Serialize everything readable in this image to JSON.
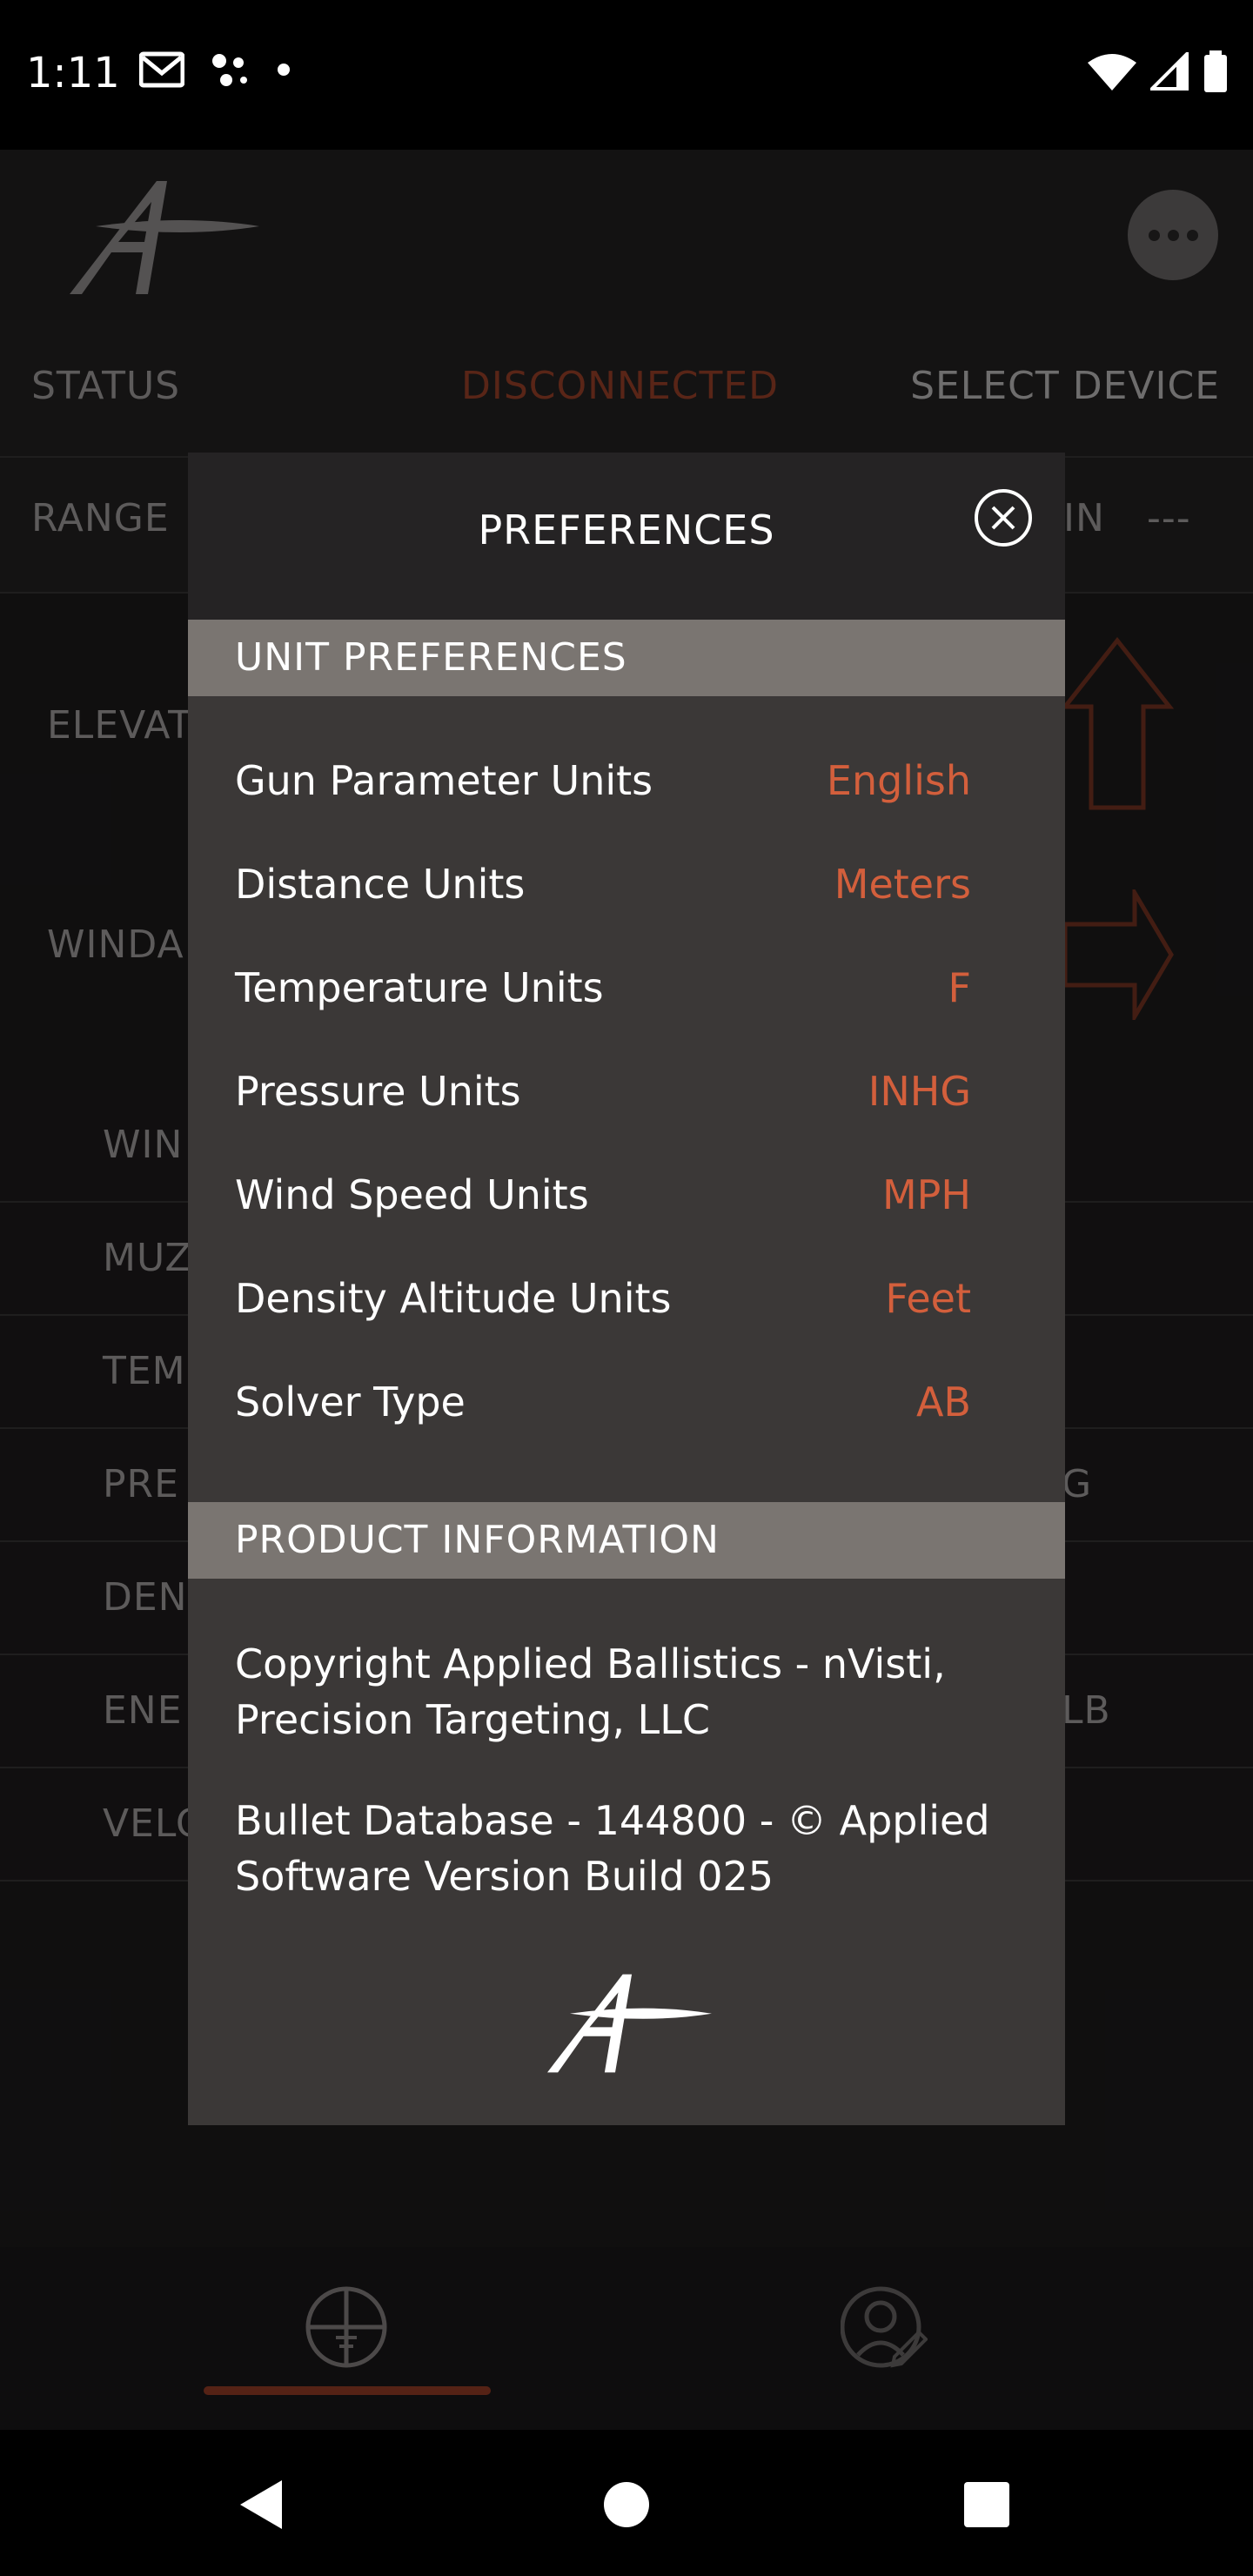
{
  "status_bar": {
    "time": "1:11"
  },
  "app": {
    "header": {
      "logo_icon": "applied-ballistics-logo",
      "menu_icon": "more-horizontal-icon"
    },
    "status_row": {
      "label": "STATUS",
      "state": "DISCONNECTED",
      "action": "SELECT DEVICE"
    },
    "range_row": {
      "label": "RANGE",
      "right_unit": "IN",
      "right_value": "---"
    },
    "elevation_label": "ELEVAT",
    "windage_label": "WINDA",
    "data_rows": [
      {
        "label": "WIN"
      },
      {
        "label": "MUZ"
      },
      {
        "label": "TEM"
      },
      {
        "label": "PRE",
        "right": "G"
      },
      {
        "label": "DEN"
      },
      {
        "label": "ENE",
        "right": "LB"
      },
      {
        "label": "VELO"
      }
    ],
    "bottom_nav": {
      "tab1_icon": "crosshair-icon",
      "tab2_icon": "profile-edit-icon"
    }
  },
  "modal": {
    "title": "PREFERENCES",
    "unit_section_title": "UNIT PREFERENCES",
    "units": [
      {
        "label": "Gun Parameter Units",
        "value": "English"
      },
      {
        "label": "Distance Units",
        "value": "Meters"
      },
      {
        "label": "Temperature Units",
        "value": "F"
      },
      {
        "label": "Pressure Units",
        "value": "INHG"
      },
      {
        "label": "Wind Speed Units",
        "value": "MPH"
      },
      {
        "label": "Density Altitude Units",
        "value": "Feet"
      },
      {
        "label": "Solver Type",
        "value": "AB"
      }
    ],
    "product_section_title": "PRODUCT INFORMATION",
    "copyright_line1": "Copyright Applied Ballistics - nVisti,",
    "copyright_line2": "Precision Targeting, LLC",
    "database_line1": "Bullet Database - 144800 - © Applied",
    "database_line2": "Software Version Build 025"
  },
  "colors": {
    "accent": "#d35f3c",
    "disconnected": "#a2442b",
    "section_bar": "#7a7571",
    "modal_bg": "#3b3837"
  }
}
